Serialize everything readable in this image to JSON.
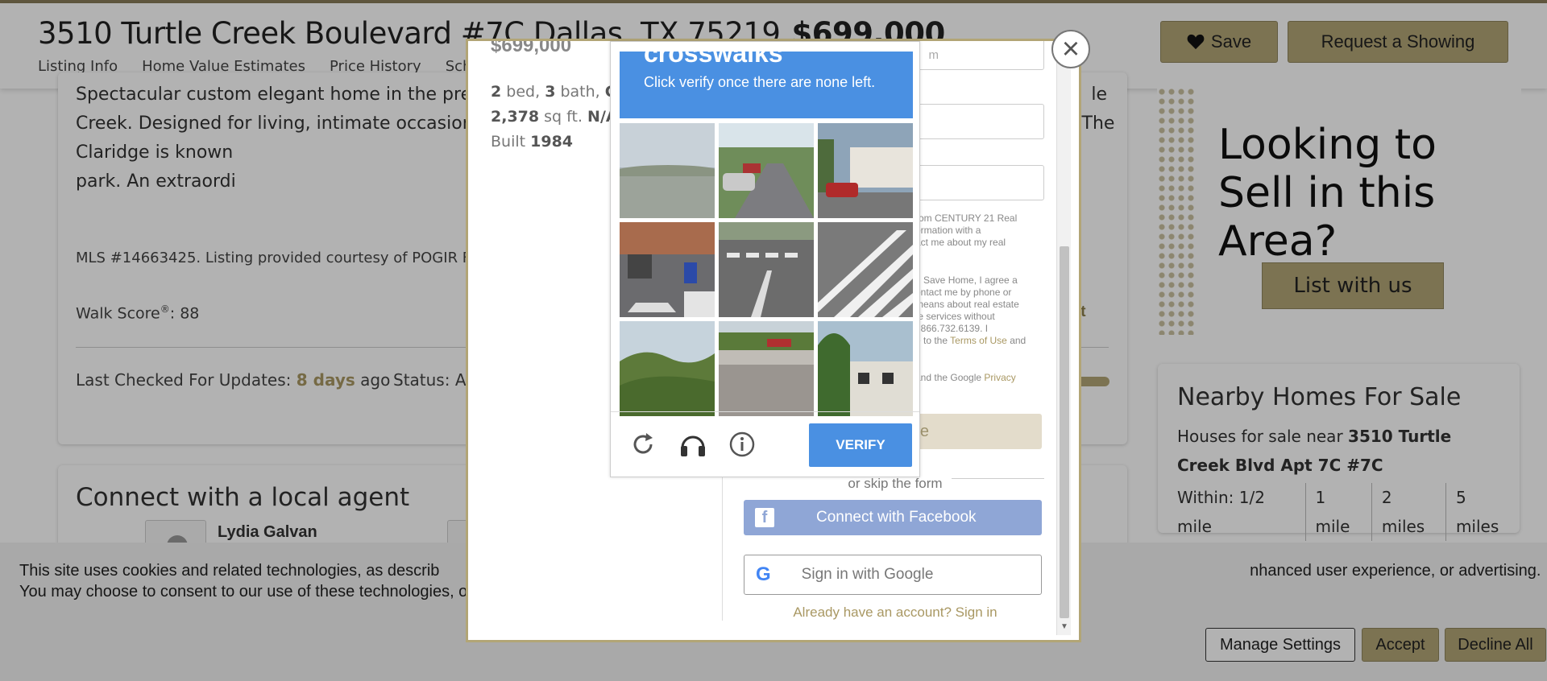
{
  "header": {
    "address": "3510 Turtle Creek Boulevard #7C Dallas, TX 75219",
    "price": "$699,000",
    "nav": [
      "Listing Info",
      "Home Value Estimates",
      "Price History",
      "School"
    ],
    "save_label": "Save",
    "showing_label": "Request a Showing"
  },
  "listing": {
    "description": "Spectacular custom elegant home in the pre                                                                                                              le Creek. Designed for living, intimate occasion spaces extra large dining room, study, balcor generous bathrooms. The Claridge is known                                                                                                        ol, racquet ball court and dog park. An extraordi",
    "mls": "MLS #14663425. Listing provided courtesy of POGIR F",
    "walk_score_label": "Walk Score",
    "walk_score_sup": "®",
    "walk_score_value": ": 88",
    "print_label": "rint",
    "checked_label": "Last Checked For Updates:",
    "checked_value": "8 days",
    "checked_suffix": "ago",
    "status_label": "Status: A"
  },
  "agent_section": {
    "title": "Connect with a local agent",
    "agent_name": "Lydia Galvan"
  },
  "ad": {
    "title": "Looking to Sell in this Area?",
    "button": "List with us"
  },
  "nearby": {
    "title": "Nearby Homes For Sale",
    "text_prefix": "Houses for sale near",
    "text_bold": "3510 Turtle Creek Blvd Apt 7C #7C",
    "within_label": "Within: 1/2 mile",
    "distances": [
      "1 mile",
      "2 miles",
      "5 miles"
    ]
  },
  "cookie": {
    "text": "This site uses cookies and related technologies, as describ                                                                                                                                                                                     nhanced user experience, or advertising. You may choose to consent to our use of these technologies, or manage your",
    "manage": "Manage Settings",
    "accept": "Accept",
    "decline": "Decline All"
  },
  "modal": {
    "close": "×",
    "price": "$699,000",
    "beds": "2",
    "beds_label": "bed,",
    "baths": "3",
    "baths_label": "bath,",
    "cn": "CN",
    "sqft": "2,378",
    "sqft_label": "sq ft.",
    "na": "N/A",
    "built_label": "Built",
    "built": "1984",
    "form_placeholder_1": "m",
    "legal_1": [
      "rom CENTURY 21 Real",
      "ormation with a",
      "act me about my real"
    ],
    "legal_2": [
      "g Save Home, I agree a",
      "ontact me by phone or",
      "means about real estate",
      "te services without",
      ": 866.732.6139. I"
    ],
    "legal_terms_prefix": "e to the",
    "legal_terms_link": "Terms of Use",
    "legal_terms_suffix": "and",
    "legal_privacy_prefix": "and the Google",
    "legal_privacy_link": "Privacy",
    "submit_partial": "ne",
    "skip": "or skip the form",
    "facebook": "Connect with Facebook",
    "google": "Sign in with Google",
    "signin": "Already have an account? Sign in"
  },
  "captcha": {
    "target_word": "crosswalks",
    "instruction": "Click verify once there are none left.",
    "verify": "VERIFY",
    "tiles": [
      "water-landscape",
      "street-cars",
      "palm-house-car",
      "street-intersection",
      "street-crosswalk",
      "zebra-crosswalk",
      "forest-hill",
      "road-barrier",
      "palm-building"
    ]
  },
  "colors": {
    "accent_gold": "#b2a576",
    "captcha_blue": "#4a90e2",
    "facebook_blue": "#8fa6d6"
  }
}
